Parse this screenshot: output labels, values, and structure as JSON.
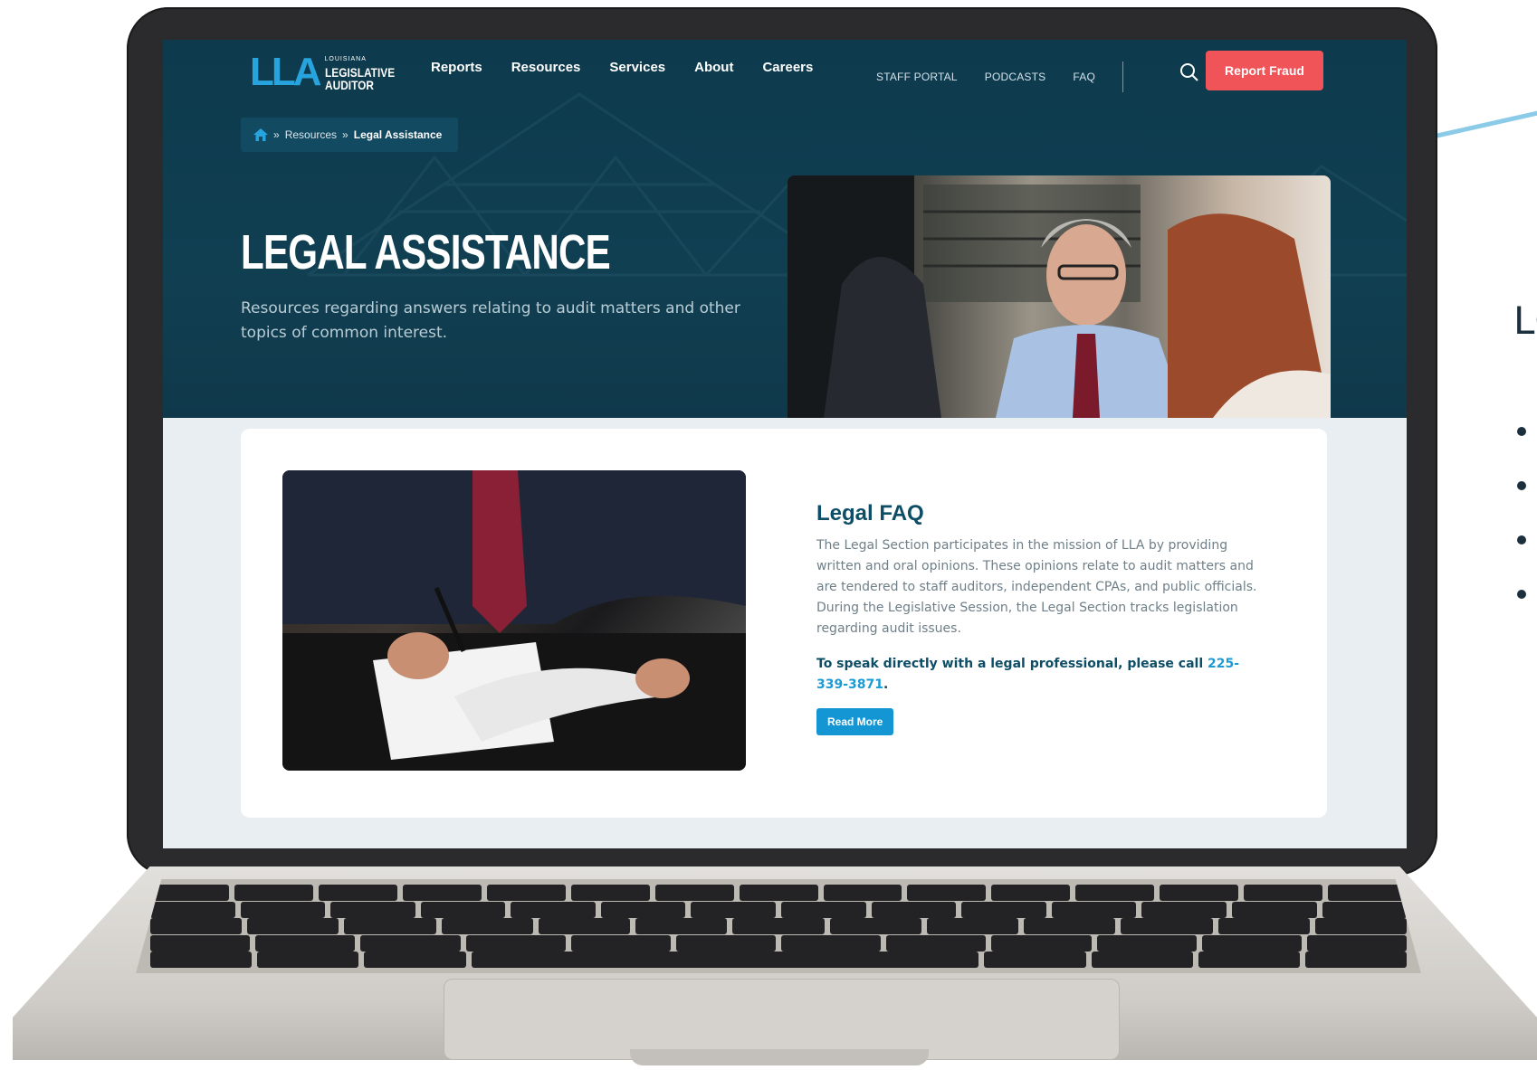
{
  "site": {
    "logo": {
      "mark": "LLA",
      "line1": "LOUISIANA",
      "line2": "LEGISLATIVE",
      "line3": "AUDITOR"
    },
    "nav_main": [
      "Reports",
      "Resources",
      "Services",
      "About",
      "Careers"
    ],
    "nav_util": [
      "STAFF PORTAL",
      "PODCASTS",
      "FAQ"
    ],
    "report_fraud": "Report Fraud",
    "breadcrumb": {
      "sep": "»",
      "parent": "Resources",
      "current": "Legal Assistance"
    },
    "hero": {
      "title": "LEGAL ASSISTANCE",
      "description": "Resources regarding answers relating to audit matters and other topics of common interest."
    },
    "card": {
      "title": "Legal FAQ",
      "text": "The Legal Section participates in the mission of LLA by providing written and oral opinions. These opinions relate to audit matters and are tendered to staff auditors, independent CPAs, and public officials. During the Legislative Session, the Legal Section tracks legislation regarding audit issues.",
      "call_prefix": "To speak directly with a legal professional, please call ",
      "phone": "225-339-3871",
      "call_suffix": ".",
      "button": "Read More"
    }
  },
  "side_panel": {
    "heading": "LG"
  },
  "colors": {
    "hero_bg": "#0d3a4d",
    "accent_blue": "#1496d4",
    "fraud_red": "#f05358",
    "title_teal": "#0e4d66"
  }
}
